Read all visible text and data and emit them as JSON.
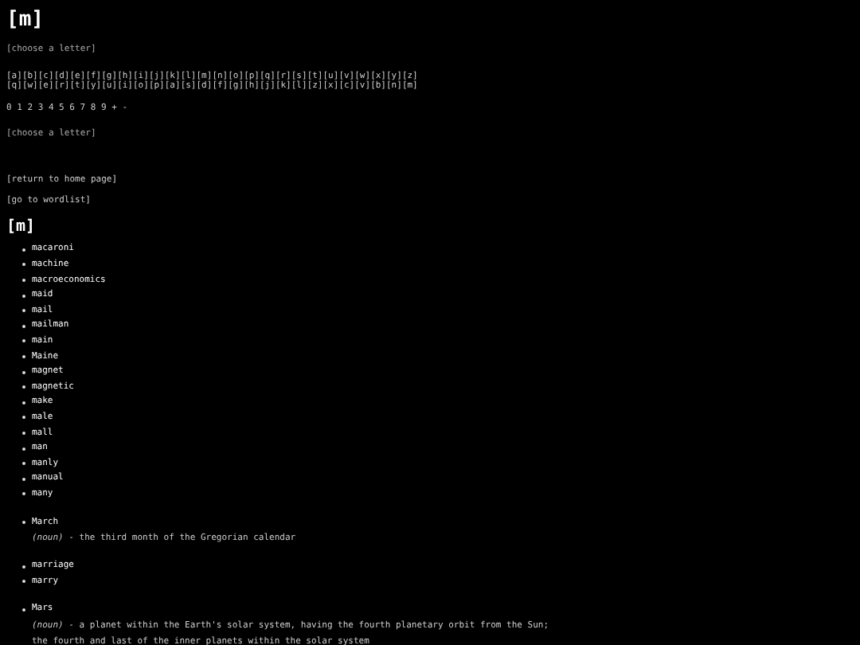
{
  "title": "[m]",
  "choose_letter_top": "[choose a letter]",
  "letter_rows": [
    [
      "[a]",
      "[b]",
      "[c]",
      "[d]",
      "[e]",
      "[f]",
      "[g]",
      "[h]",
      "[i]",
      "[j]",
      "[k]",
      "[l]",
      "[m]",
      "[n]",
      "[o]",
      "[p]",
      "[q]",
      "[r]",
      "[s]",
      "[t]",
      "[u]",
      "[v]",
      "[w]",
      "[x]",
      "[y]",
      "[z]"
    ],
    [
      "[q]",
      "[w]",
      "[e]",
      "[r]",
      "[t]",
      "[y]",
      "[u]",
      "[i]",
      "[o]",
      "[p]",
      "[a]",
      "[s]",
      "[d]",
      "[f]",
      "[g]",
      "[h]",
      "[j]",
      "[k]",
      "[l]",
      "[z]",
      "[x]",
      "[c]",
      "[v]",
      "[b]",
      "[n]",
      "[m]"
    ]
  ],
  "digit_row": [
    "0",
    "1",
    "2",
    "3",
    "4",
    "5",
    "6",
    "7",
    "8",
    "9",
    "+",
    "-"
  ],
  "choose_letter_bottom": "[choose a letter]",
  "nav_links": [
    "[return to home page]",
    "[go to wordlist]"
  ],
  "section_heading": "[m]",
  "groups": [
    {
      "entries": [
        {
          "word": "macaroni"
        },
        {
          "word": "machine"
        },
        {
          "word": "macroeconomics"
        },
        {
          "word": "maid"
        },
        {
          "word": "mail"
        },
        {
          "word": "mailman"
        },
        {
          "word": "main"
        },
        {
          "word": "Maine"
        },
        {
          "word": "magnet"
        },
        {
          "word": "magnetic"
        },
        {
          "word": "make"
        },
        {
          "word": "male"
        },
        {
          "word": "mall"
        },
        {
          "word": "man"
        },
        {
          "word": "manly"
        },
        {
          "word": "manual"
        },
        {
          "word": "many"
        }
      ]
    },
    {
      "entries": [
        {
          "word": "March",
          "definition": "*(noun)* - the third month of the Gregorian calendar"
        }
      ]
    },
    {
      "entries": [
        {
          "word": "marriage"
        },
        {
          "word": "marry"
        }
      ]
    },
    {
      "entries": [
        {
          "word": "Mars",
          "definition": "*(noun)* - a planet within the Earth's solar system, having the fourth planetary orbit from the Sun; the fourth and last of the inner planets within the solar system"
        }
      ]
    }
  ]
}
